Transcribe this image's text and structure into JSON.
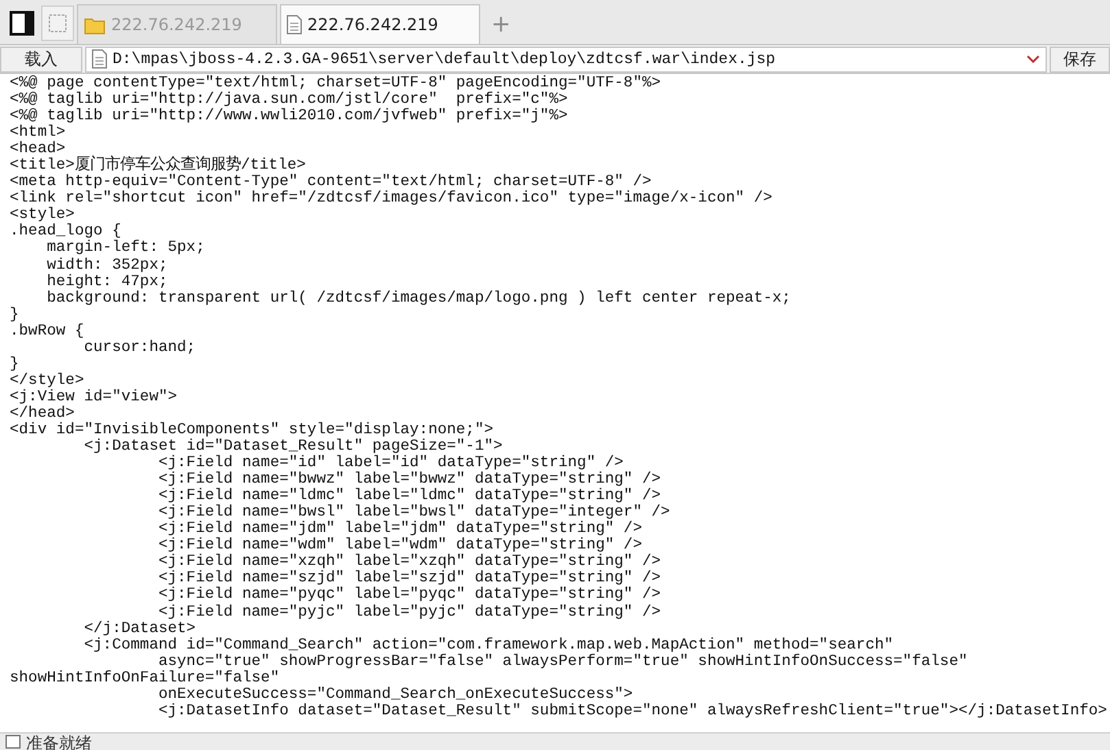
{
  "tabs": [
    {
      "kind": "folder",
      "label": "222.76.242.219",
      "selected": false
    },
    {
      "kind": "file",
      "label": "222.76.242.219",
      "selected": true
    }
  ],
  "new_tab": "+",
  "address_bar": {
    "load_button": "载入",
    "path": "D:\\mpas\\jboss-4.2.3.GA-9651\\server\\default\\deploy\\zdtcsf.war\\index.jsp",
    "save_button": "保存"
  },
  "code_lines": [
    "<%@ page contentType=\"text/html; charset=UTF-8\" pageEncoding=\"UTF-8\"%>",
    "<%@ taglib uri=\"http://java.sun.com/jstl/core\"  prefix=\"c\"%>",
    "<%@ taglib uri=\"http://www.wwli2010.com/jvfweb\" prefix=\"j\"%>",
    "<html>",
    "<head>",
    "<title>厦门市停车公众查询服势/title>",
    "<meta http-equiv=\"Content-Type\" content=\"text/html; charset=UTF-8\" />",
    "<link rel=\"shortcut icon\" href=\"/zdtcsf/images/favicon.ico\" type=\"image/x-icon\" />",
    "<style>",
    ".head_logo {",
    "    margin-left: 5px;",
    "    width: 352px;",
    "    height: 47px;",
    "    background: transparent url( /zdtcsf/images/map/logo.png ) left center repeat-x;",
    "}",
    ".bwRow {",
    "        cursor:hand;",
    "}",
    "</style>",
    "<j:View id=\"view\">",
    "</head>",
    "<div id=\"InvisibleComponents\" style=\"display:none;\">",
    "        <j:Dataset id=\"Dataset_Result\" pageSize=\"-1\">",
    "                <j:Field name=\"id\" label=\"id\" dataType=\"string\" />",
    "                <j:Field name=\"bwwz\" label=\"bwwz\" dataType=\"string\" />",
    "                <j:Field name=\"ldmc\" label=\"ldmc\" dataType=\"string\" />",
    "                <j:Field name=\"bwsl\" label=\"bwsl\" dataType=\"integer\" />",
    "                <j:Field name=\"jdm\" label=\"jdm\" dataType=\"string\" />",
    "                <j:Field name=\"wdm\" label=\"wdm\" dataType=\"string\" />",
    "                <j:Field name=\"xzqh\" label=\"xzqh\" dataType=\"string\" />",
    "                <j:Field name=\"szjd\" label=\"szjd\" dataType=\"string\" />",
    "                <j:Field name=\"pyqc\" label=\"pyqc\" dataType=\"string\" />",
    "                <j:Field name=\"pyjc\" label=\"pyjc\" dataType=\"string\" />",
    "        </j:Dataset>",
    "        <j:Command id=\"Command_Search\" action=\"com.framework.map.web.MapAction\" method=\"search\"",
    "                async=\"true\" showProgressBar=\"false\" alwaysPerform=\"true\" showHintInfoOnSuccess=\"false\"",
    "showHintInfoOnFailure=\"false\"",
    "                onExecuteSuccess=\"Command_Search_onExecuteSuccess\">",
    "                <j:DatasetInfo dataset=\"Dataset_Result\" submitScope=\"none\" alwaysRefreshClient=\"true\"></j:DatasetInfo>"
  ],
  "status_bar": "准备就绪"
}
